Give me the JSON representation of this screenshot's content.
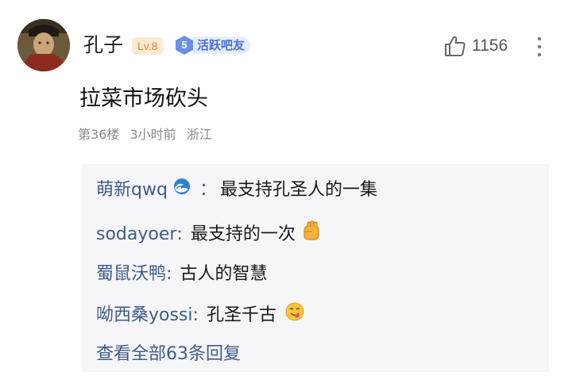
{
  "comment": {
    "author": "孔子",
    "level": "Lv.8",
    "fan_badge": {
      "level": "5",
      "label": "活跃吧友"
    },
    "like_count": "1156",
    "text": "拉菜市场砍头",
    "meta": {
      "floor": "第36楼",
      "time": "3小时前",
      "location": "浙江"
    }
  },
  "replies": [
    {
      "user": "萌新qwq",
      "sep": "：",
      "content": "最支持孔圣人的一集",
      "emoji": "wave-emoji"
    },
    {
      "user": "sodayoer",
      "sep": ":",
      "content": "最支持的一次",
      "emoji": "fist-emoji"
    },
    {
      "user": "蜀鼠沃鸭",
      "sep": ":",
      "content": "古人的智慧",
      "emoji": ""
    },
    {
      "user": "呦西桑yossi",
      "sep": ":",
      "content": "孔圣千古",
      "emoji": "yum-emoji"
    }
  ],
  "view_all": "查看全部63条回复",
  "icons": {
    "like": "thumbs-up-icon",
    "more": "more-vertical-icon"
  },
  "colors": {
    "username_blue": "#3e5c8a",
    "level_orange": "#d98a2a",
    "badge_blue": "#4a6fd0",
    "reply_bg": "#f6f5f7",
    "meta_gray": "#8a8a8a"
  }
}
